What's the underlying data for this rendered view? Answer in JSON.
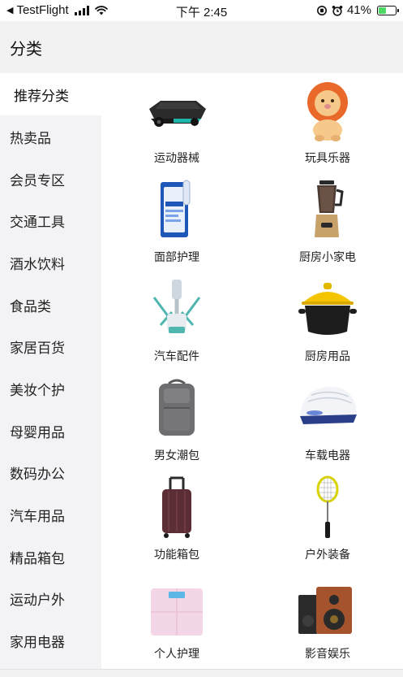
{
  "status_bar": {
    "back_arrow": "◀",
    "app": "TestFlight",
    "time": "下午 2:45",
    "battery": "41%"
  },
  "header": {
    "title": "分类"
  },
  "sidebar": {
    "items": [
      {
        "label": "推荐分类",
        "active": true
      },
      {
        "label": "热卖品"
      },
      {
        "label": "会员专区"
      },
      {
        "label": "交通工具"
      },
      {
        "label": "酒水饮料"
      },
      {
        "label": "食品类"
      },
      {
        "label": "家居百货"
      },
      {
        "label": "美妆个护"
      },
      {
        "label": "母婴用品"
      },
      {
        "label": "数码办公"
      },
      {
        "label": "汽车用品"
      },
      {
        "label": "精品箱包"
      },
      {
        "label": "运动户外"
      },
      {
        "label": "家用电器"
      }
    ]
  },
  "grid": {
    "items": [
      {
        "label": "运动器械",
        "icon": "balance-board-icon"
      },
      {
        "label": "玩具乐器",
        "icon": "lion-toy-icon"
      },
      {
        "label": "面部护理",
        "icon": "face-mask-icon"
      },
      {
        "label": "厨房小家电",
        "icon": "blender-icon"
      },
      {
        "label": "汽车配件",
        "icon": "car-mount-icon"
      },
      {
        "label": "厨房用品",
        "icon": "casserole-pot-icon"
      },
      {
        "label": "男女潮包",
        "icon": "backpack-icon"
      },
      {
        "label": "车载电器",
        "icon": "car-purifier-icon"
      },
      {
        "label": "功能箱包",
        "icon": "suitcase-icon"
      },
      {
        "label": "户外装备",
        "icon": "badminton-racket-icon"
      },
      {
        "label": "个人护理",
        "icon": "bathroom-scale-icon"
      },
      {
        "label": "影音娱乐",
        "icon": "speaker-icon"
      }
    ]
  }
}
